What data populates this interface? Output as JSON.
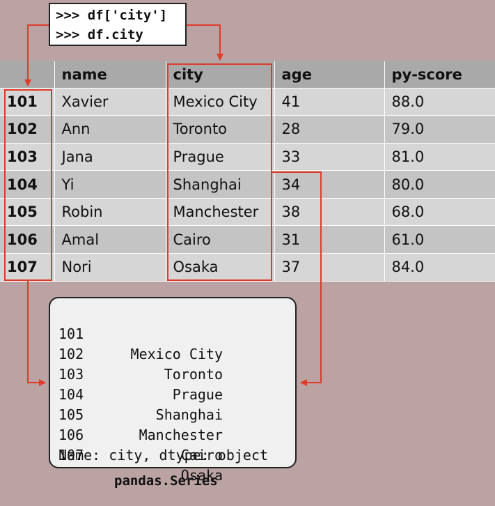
{
  "code": {
    "line1": ">>> df['city']",
    "line2": ">>> df.city"
  },
  "table": {
    "columns": [
      "name",
      "city",
      "age",
      "py-score"
    ],
    "rows": [
      {
        "index": "101",
        "name": "Xavier",
        "city": "Mexico City",
        "age": "41",
        "py_score": "88.0"
      },
      {
        "index": "102",
        "name": "Ann",
        "city": "Toronto",
        "age": "28",
        "py_score": "79.0"
      },
      {
        "index": "103",
        "name": "Jana",
        "city": "Prague",
        "age": "33",
        "py_score": "81.0"
      },
      {
        "index": "104",
        "name": "Yi",
        "city": "Shanghai",
        "age": "34",
        "py_score": "80.0"
      },
      {
        "index": "105",
        "name": "Robin",
        "city": "Manchester",
        "age": "38",
        "py_score": "68.0"
      },
      {
        "index": "106",
        "name": "Amal",
        "city": "Cairo",
        "age": "31",
        "py_score": "61.0"
      },
      {
        "index": "107",
        "name": "Nori",
        "city": "Osaka",
        "age": "37",
        "py_score": "84.0"
      }
    ]
  },
  "series": {
    "rows": [
      {
        "index": "101",
        "value": "Mexico City"
      },
      {
        "index": "102",
        "value": "Toronto"
      },
      {
        "index": "103",
        "value": "Prague"
      },
      {
        "index": "104",
        "value": "Shanghai"
      },
      {
        "index": "105",
        "value": "Manchester"
      },
      {
        "index": "106",
        "value": "Cairo"
      },
      {
        "index": "107",
        "value": "Osaka"
      }
    ],
    "footer": "Name: city, dtype: object",
    "caption": "pandas.Series"
  },
  "colors": {
    "background": "#bba3a3",
    "highlight": "#e03a2a",
    "header": "#a9a9a9",
    "row_light": "#d6d6d6",
    "row_dark": "#c4c4c4"
  }
}
